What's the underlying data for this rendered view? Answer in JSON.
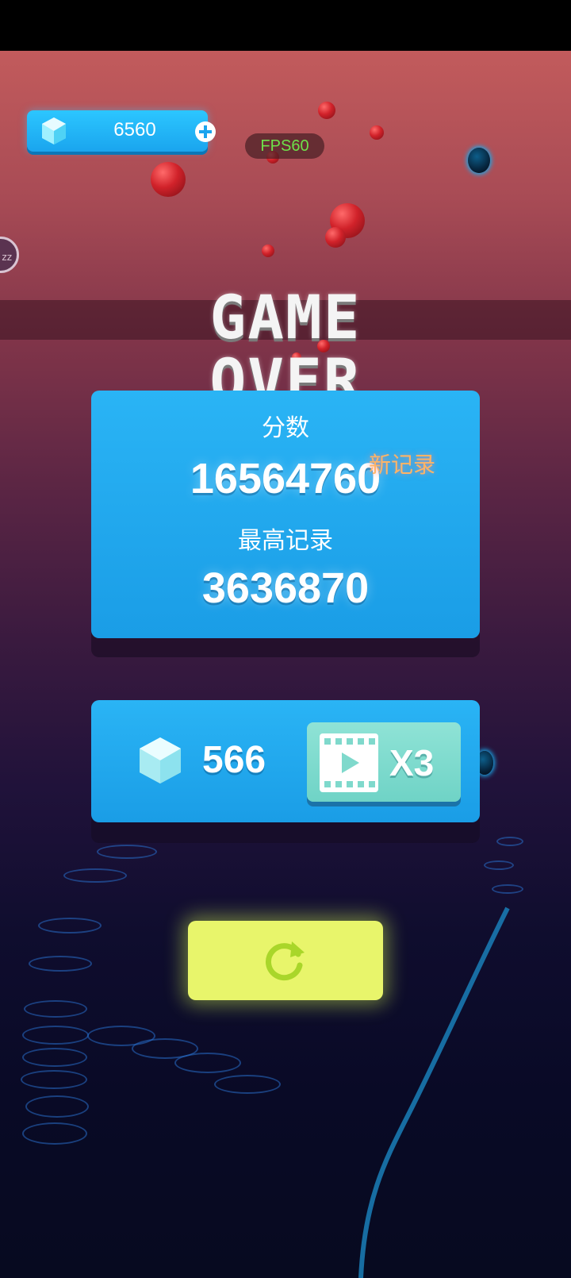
{
  "hud": {
    "gem_count": "6560",
    "fps_label": "FPS60",
    "side_button_text": "zz"
  },
  "title": "GAME OVER",
  "score_card": {
    "score_label": "分数",
    "score_value": "16564760",
    "new_record_badge": "新记录",
    "best_label": "最高记录",
    "best_value": "3636870"
  },
  "reward": {
    "gem_amount": "566",
    "multiplier_label": "X3"
  },
  "icons": {
    "gem": "gem-icon",
    "plus": "plus-icon",
    "video": "video-icon",
    "retry": "restart-icon"
  },
  "colors": {
    "card_blue": "#1fa8ee",
    "retry_yellow": "#e8f56b",
    "fps_green": "#6ee14a",
    "new_record": "#ffb466"
  }
}
